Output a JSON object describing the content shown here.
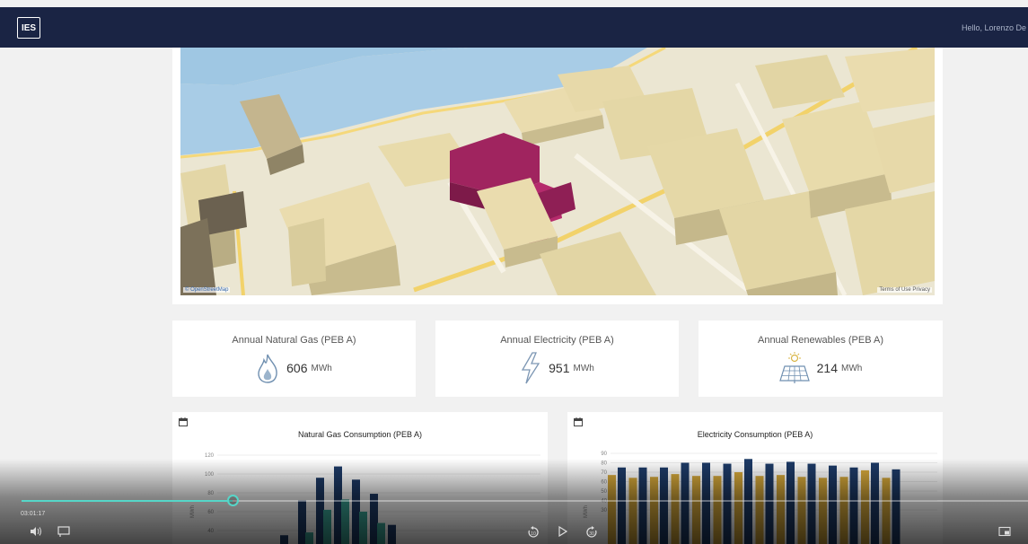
{
  "app": {
    "logo": "IES",
    "greeting": "Hello, Lorenzo De"
  },
  "map": {
    "attribution": "© OpenStreetMap",
    "terms": "Terms of Use  Privacy"
  },
  "kpis": [
    {
      "title": "Annual Natural Gas (PEB A)",
      "value": "606",
      "unit": "MWh",
      "icon": "flame-icon"
    },
    {
      "title": "Annual Electricity (PEB A)",
      "value": "951",
      "unit": "MWh",
      "icon": "lightning-icon"
    },
    {
      "title": "Annual Renewables (PEB A)",
      "value": "214",
      "unit": "MWh",
      "icon": "solar-panel-icon"
    }
  ],
  "charts": [
    {
      "title": "Natural Gas Consumption (PEB A)",
      "chart_data": {
        "type": "bar",
        "ylabel": "MWh",
        "ylim": [
          0,
          120
        ],
        "yticks": [
          "120",
          "100",
          "80",
          "60",
          "40"
        ],
        "series": [
          {
            "color": "#3aa597",
            "values": [
              0,
              25,
              38,
              62,
              73,
              60,
              48,
              0,
              0
            ]
          },
          {
            "color": "#1d3a66",
            "values": [
              35,
              72,
              96,
              108,
              94,
              79,
              46,
              0,
              0
            ]
          }
        ]
      }
    },
    {
      "title": "Electricity Consumption (PEB A)",
      "chart_data": {
        "type": "bar",
        "ylabel": "MWh",
        "ylim": [
          0,
          90
        ],
        "yticks": [
          "90",
          "80",
          "70",
          "60",
          "50",
          "40",
          "30"
        ],
        "series": [
          {
            "color": "#d4a73a",
            "values": [
              67,
              64,
              65,
              68,
              66,
              66,
              70,
              66,
              67,
              65,
              64,
              65,
              72,
              64
            ]
          },
          {
            "color": "#1d3a66",
            "values": [
              75,
              75,
              75,
              80,
              80,
              79,
              84,
              79,
              81,
              79,
              77,
              75,
              80,
              73
            ]
          }
        ]
      }
    }
  ],
  "player": {
    "current_time": "03:01:17",
    "progress": 0.21,
    "accent": "#56d6c8"
  }
}
